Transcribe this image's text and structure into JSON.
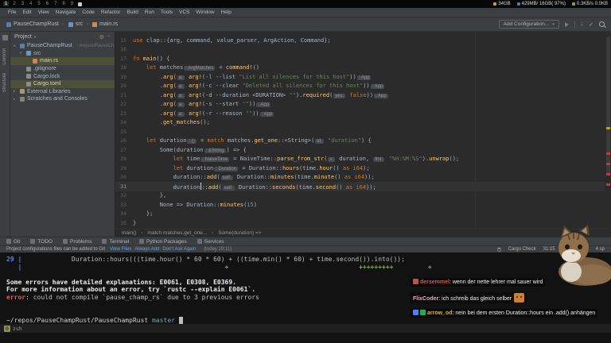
{
  "sysbar": {
    "workspaces": [
      "1",
      "2",
      "3",
      "4",
      "5",
      "6",
      "7",
      "8",
      "9"
    ],
    "active_workspace": "1",
    "stats": [
      {
        "color": "#c8a13e",
        "text": "34GB"
      },
      {
        "color": "#4f7fa3",
        "text": "429MB/ 16GB( 97%)"
      },
      {
        "color": "#8f9a3a",
        "text": "0.3KB/s 0.0KB"
      }
    ]
  },
  "menubar": {
    "items": [
      "File",
      "Edit",
      "View",
      "Navigate",
      "Code",
      "Refactor",
      "Build",
      "Run",
      "Tools",
      "VCS",
      "Window",
      "Help"
    ]
  },
  "navbar": {
    "breadcrumbs": [
      {
        "label": "PauseChampRust",
        "icon": "root"
      },
      {
        "label": "src",
        "icon": "folder"
      },
      {
        "label": "main.rs",
        "icon": "rust"
      }
    ],
    "add_configuration": "Add Configuration..."
  },
  "leftstrip": {
    "labels": [
      "Commit",
      "Structure"
    ]
  },
  "project": {
    "header": "Project",
    "tree": [
      {
        "depth": 0,
        "arrow": "▾",
        "icon": "root",
        "label": "PauseChampRust",
        "suffix": "~/repos/PauseCha"
      },
      {
        "depth": 1,
        "arrow": "▾",
        "icon": "folder",
        "label": "src"
      },
      {
        "depth": 2,
        "arrow": "",
        "icon": "rust",
        "label": "main.rs",
        "selected": true
      },
      {
        "depth": 1,
        "arrow": "",
        "icon": "file",
        "label": ".gitignore"
      },
      {
        "depth": 1,
        "arrow": "",
        "icon": "file",
        "label": "Cargo.lock"
      },
      {
        "depth": 1,
        "arrow": "",
        "icon": "file",
        "label": "Cargo.toml",
        "selected": true
      },
      {
        "depth": 0,
        "arrow": "▸",
        "icon": "lib",
        "label": "External Libraries"
      },
      {
        "depth": 0,
        "arrow": "▸",
        "icon": "scratch",
        "label": "Scratches and Consoles"
      }
    ]
  },
  "editor": {
    "breadcrumbs": [
      "main()",
      "match matches.get_one...",
      "Some(duration) =>"
    ],
    "lines": [
      {
        "n": "15",
        "seg": [
          [
            "k",
            "use "
          ],
          [
            "t",
            "clap::{arg, command, value_parser, ArgAction, Command};"
          ]
        ]
      },
      {
        "n": "16",
        "seg": []
      },
      {
        "n": "17",
        "seg": [
          [
            "k",
            "fn "
          ],
          [
            "f",
            "main"
          ],
          [
            "t",
            "() {"
          ]
        ]
      },
      {
        "n": "18",
        "seg": [
          [
            "t",
            "    "
          ],
          [
            "k",
            "let "
          ],
          [
            "t",
            "matches"
          ],
          [
            "i",
            ": ArgMatches"
          ],
          [
            "t",
            " = "
          ],
          [
            "m",
            "command!"
          ],
          [
            "t",
            "()"
          ]
        ]
      },
      {
        "n": "19",
        "seg": [
          [
            "t",
            "        ."
          ],
          [
            "f",
            "arg"
          ],
          [
            "t",
            "("
          ],
          [
            "i",
            "a:"
          ],
          [
            "t",
            " "
          ],
          [
            "m",
            "arg!"
          ],
          [
            "t",
            "(-l --list "
          ],
          [
            "s",
            "\"List all silences for this host\""
          ],
          [
            "t",
            "))"
          ],
          [
            "i",
            ": App"
          ]
        ]
      },
      {
        "n": "20",
        "seg": [
          [
            "t",
            "        ."
          ],
          [
            "f",
            "arg"
          ],
          [
            "t",
            "("
          ],
          [
            "i",
            "a:"
          ],
          [
            "t",
            " "
          ],
          [
            "m",
            "arg!"
          ],
          [
            "t",
            "(-c --clear "
          ],
          [
            "s",
            "\"Deleted all silences for this host\""
          ],
          [
            "t",
            "))"
          ],
          [
            "i",
            ": App"
          ]
        ]
      },
      {
        "n": "21",
        "seg": [
          [
            "t",
            "        ."
          ],
          [
            "f",
            "arg"
          ],
          [
            "t",
            "("
          ],
          [
            "i",
            "a:"
          ],
          [
            "t",
            " "
          ],
          [
            "m",
            "arg!"
          ],
          [
            "t",
            "(-d --duration <DURATION> "
          ],
          [
            "s",
            "\"\""
          ],
          [
            "t",
            ")."
          ],
          [
            "f",
            "required"
          ],
          [
            "t",
            "("
          ],
          [
            "i",
            "yes:"
          ],
          [
            "t",
            " "
          ],
          [
            "k",
            "false"
          ],
          [
            "t",
            "))"
          ],
          [
            "i",
            ": App"
          ]
        ]
      },
      {
        "n": "22",
        "seg": [
          [
            "t",
            "        ."
          ],
          [
            "f",
            "arg"
          ],
          [
            "t",
            "("
          ],
          [
            "i",
            "a:"
          ],
          [
            "t",
            " "
          ],
          [
            "m",
            "arg!"
          ],
          [
            "t",
            "(-s --start "
          ],
          [
            "s",
            "\"\""
          ],
          [
            "t",
            "))"
          ],
          [
            "i",
            ": App"
          ]
        ]
      },
      {
        "n": "23",
        "seg": [
          [
            "t",
            "        ."
          ],
          [
            "f",
            "arg"
          ],
          [
            "t",
            "("
          ],
          [
            "i",
            "a:"
          ],
          [
            "t",
            " "
          ],
          [
            "m",
            "arg!"
          ],
          [
            "t",
            "(-r --reason "
          ],
          [
            "s",
            "\"\""
          ],
          [
            "t",
            "))"
          ],
          [
            "i",
            ": App"
          ]
        ]
      },
      {
        "n": "24",
        "seg": [
          [
            "t",
            "        ."
          ],
          [
            "f",
            "get_matches"
          ],
          [
            "t",
            "();"
          ]
        ]
      },
      {
        "n": "25",
        "seg": []
      },
      {
        "n": "26",
        "seg": [
          [
            "t",
            "    "
          ],
          [
            "k",
            "let "
          ],
          [
            "t",
            "duration"
          ],
          [
            "i",
            ": ()"
          ],
          [
            "t",
            " = "
          ],
          [
            "k",
            "match"
          ],
          [
            "t",
            " matches."
          ],
          [
            "f",
            "get_one"
          ],
          [
            "t",
            "::<String>("
          ],
          [
            "i",
            "id:"
          ],
          [
            "t",
            " "
          ],
          [
            "s",
            "\"duration\""
          ],
          [
            "t",
            ") {"
          ]
        ]
      },
      {
        "n": "27",
        "seg": [
          [
            "t",
            "        Some(duration"
          ],
          [
            "i",
            ": &String"
          ],
          [
            "t",
            ") => {"
          ]
        ]
      },
      {
        "n": "28",
        "seg": [
          [
            "t",
            "            "
          ],
          [
            "k",
            "let "
          ],
          [
            "t",
            "time"
          ],
          [
            "i",
            ": NaiveTime"
          ],
          [
            "t",
            " = NaiveTime::"
          ],
          [
            "f",
            "parse_from_str"
          ],
          [
            "t",
            "("
          ],
          [
            "i",
            "s:"
          ],
          [
            "t",
            " duration, "
          ],
          [
            "i",
            "fmt:"
          ],
          [
            "t",
            " "
          ],
          [
            "s",
            "\"%H:%M:%S\""
          ],
          [
            "t",
            ")."
          ],
          [
            "f",
            "unwrap"
          ],
          [
            "t",
            "();"
          ]
        ]
      },
      {
        "n": "29",
        "seg": [
          [
            "t",
            "            "
          ],
          [
            "k",
            "let "
          ],
          [
            "t",
            "duration"
          ],
          [
            "i",
            ": Duration"
          ],
          [
            "t",
            " = Duration::"
          ],
          [
            "f",
            "hours"
          ],
          [
            "t",
            "(time."
          ],
          [
            "f",
            "hour"
          ],
          [
            "t",
            "() "
          ],
          [
            "k",
            "as i64"
          ],
          [
            "t",
            ");"
          ]
        ]
      },
      {
        "n": "30",
        "seg": [
          [
            "t",
            "            duration::"
          ],
          [
            "f",
            "add"
          ],
          [
            "t",
            "("
          ],
          [
            "i",
            "self:"
          ],
          [
            "t",
            " Duration::"
          ],
          [
            "f",
            "minutes"
          ],
          [
            "t",
            "(time."
          ],
          [
            "f",
            "minute"
          ],
          [
            "t",
            "() "
          ],
          [
            "k",
            "as i64"
          ],
          [
            "t",
            "));"
          ]
        ]
      },
      {
        "n": "31",
        "active": true,
        "seg": [
          [
            "t",
            "            duration"
          ],
          [
            "caret",
            ""
          ],
          [
            "t",
            "::"
          ],
          [
            "f",
            "add"
          ],
          [
            "t",
            "("
          ],
          [
            "i",
            "self:"
          ],
          [
            "t",
            " Duration::"
          ],
          [
            "f",
            "seconds"
          ],
          [
            "t",
            "(time."
          ],
          [
            "f",
            "second"
          ],
          [
            "t",
            "() "
          ],
          [
            "k",
            "as i64"
          ],
          [
            "t",
            "));"
          ]
        ]
      },
      {
        "n": "32",
        "seg": [
          [
            "t",
            "        },"
          ]
        ]
      },
      {
        "n": "33",
        "seg": [
          [
            "t",
            "        None => Duration::"
          ],
          [
            "f",
            "minutes"
          ],
          [
            "t",
            "("
          ],
          [
            "n2",
            "15"
          ],
          [
            "t",
            ")"
          ]
        ]
      },
      {
        "n": "34",
        "seg": [
          [
            "t",
            "    };"
          ]
        ]
      },
      {
        "n": "35",
        "seg": [
          [
            "t",
            "}"
          ]
        ]
      }
    ]
  },
  "toolwindows": {
    "items": [
      "Git",
      "TODO",
      "Problems",
      "Terminal",
      "Python Packages",
      "Services"
    ]
  },
  "statusbar": {
    "message": "Project configurations files can be added to Git",
    "links": [
      "View Files",
      "Always Add",
      "Don't Ask Again"
    ],
    "time": "(today 19:11)",
    "right": {
      "cargo": "Cargo Check",
      "caret": "31:15",
      "line_ending": "LF",
      "encoding": "UTF-8",
      "indent": "4 sp"
    }
  },
  "terminal": {
    "lines": [
      {
        "seg": [
          [
            "ln",
            "29"
          ],
          [
            "d",
            " "
          ],
          [
            "ln",
            "|"
          ],
          [
            "d",
            "             Duration::hours(((time.hour() * 60 * 60) + ((time.min() * 60) + time.second()).into());"
          ]
        ]
      },
      {
        "seg": [
          [
            "ln",
            "   |"
          ],
          [
            "g",
            "                                                     +                                  +++++++++         +"
          ]
        ]
      },
      {
        "seg": []
      },
      {
        "seg": [
          [
            "b",
            "Some errors have detailed explanations: E0061, E0308, E0369."
          ]
        ]
      },
      {
        "seg": [
          [
            "b",
            "For more information about an error, try `rustc --explain E0061`."
          ]
        ]
      },
      {
        "seg": [
          [
            "r",
            "error"
          ],
          [
            "d",
            ": could not compile `pause_champ_rs` due to 3 previous errors"
          ]
        ]
      },
      {
        "seg": []
      },
      {
        "seg": []
      },
      {
        "seg": [
          [
            "path",
            "~/repos/PauseChampRust/PauseChampRust"
          ],
          [
            "d",
            " "
          ],
          [
            "branch",
            "master"
          ],
          [
            "d",
            " "
          ],
          [
            "cur",
            " "
          ]
        ]
      }
    ],
    "tmux": {
      "index": "0",
      "name": "zsh"
    }
  },
  "chat": {
    "messages": [
      {
        "badges": [
          "#d04a3a"
        ],
        "user": "dersemmel",
        "color": "#e8503a",
        "text": "wenn der nette lehrer mal sauer wird",
        "emote": false
      },
      {
        "badges": [],
        "user": "FlixCoder",
        "color": "#f2a0c0",
        "text": "ich schreib das gleich selber",
        "emote": true
      },
      {
        "badges": [
          "#4d7cff",
          "#2aa85a"
        ],
        "user": "arrow_od",
        "color": "#e5b60d",
        "text": "nein bei dem ersten Duration::hours ein .add() anhängen",
        "emote": false
      }
    ]
  }
}
